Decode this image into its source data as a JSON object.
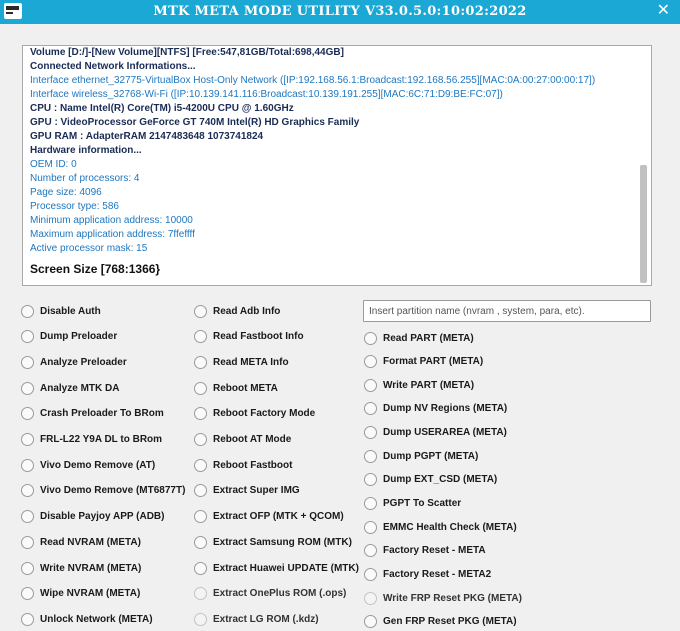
{
  "window": {
    "title": "MTK META MODE UTILITY V33.0.5.0:10:02:2022",
    "close_glyph": "✕",
    "app_icon": "app-logo-icon"
  },
  "log": [
    {
      "text": "Volume [D:/]-[New Volume][NTFS] [Free:547,81GB/Total:698,44GB]",
      "style": "dark"
    },
    {
      "text": "Connected Network Informations...",
      "style": "dark"
    },
    {
      "text": "Interface ethernet_32775-VirtualBox Host-Only Network ([IP:192.168.56.1:Broadcast:192.168.56.255][MAC:0A:00:27:00:00:17])",
      "style": "blue"
    },
    {
      "text": "Interface wireless_32768-Wi-Fi ([IP:10.139.141.116:Broadcast:10.139.191.255][MAC:6C:71:D9:BE:FC:07])",
      "style": "blue"
    },
    {
      "text": "CPU  : Name Intel(R) Core(TM) i5-4200U CPU @ 1.60GHz",
      "style": "dark"
    },
    {
      "text": "GPU  : VideoProcessor GeForce GT 740M Intel(R) HD Graphics Family",
      "style": "dark"
    },
    {
      "text": "GPU RAM  : AdapterRAM 2147483648 1073741824",
      "style": "dark"
    },
    {
      "text": "Hardware information...",
      "style": "dark"
    },
    {
      "text": "OEM ID: 0",
      "style": "blue"
    },
    {
      "text": "Number of processors: 4",
      "style": "blue"
    },
    {
      "text": "Page size: 4096",
      "style": "blue"
    },
    {
      "text": "Processor type: 586",
      "style": "blue"
    },
    {
      "text": "Minimum application address: 10000",
      "style": "blue"
    },
    {
      "text": "Maximum application address: 7ffeffff",
      "style": "blue"
    },
    {
      "text": "Active processor mask: 15",
      "style": "blue"
    },
    {
      "text": "Screen Size [768:1366}",
      "style": "big"
    }
  ],
  "col1": [
    "Disable Auth",
    "Dump Preloader",
    "Analyze Preloader",
    "Analyze MTK DA",
    "Crash Preloader To BRom",
    "FRL-L22 Y9A DL to BRom",
    "Vivo Demo Remove (AT)",
    "Vivo Demo Remove (MT6877T)",
    "Disable Payjoy APP (ADB)",
    "Read NVRAM (META)",
    "Write NVRAM (META)",
    "Wipe NVRAM (META)",
    "Unlock Network (META)"
  ],
  "col2": [
    {
      "label": "Read Adb Info",
      "enabled": true
    },
    {
      "label": "Read Fastboot Info",
      "enabled": true
    },
    {
      "label": "Read META Info",
      "enabled": true
    },
    {
      "label": "Reboot META",
      "enabled": true
    },
    {
      "label": "Reboot Factory Mode",
      "enabled": true
    },
    {
      "label": "Reboot AT Mode",
      "enabled": true
    },
    {
      "label": "Reboot Fastboot",
      "enabled": true
    },
    {
      "label": "Extract Super IMG",
      "enabled": true
    },
    {
      "label": "Extract OFP (MTK + QCOM)",
      "enabled": true
    },
    {
      "label": "Extract Samsung ROM (MTK)",
      "enabled": true
    },
    {
      "label": "Extract Huawei UPDATE (MTK)",
      "enabled": true
    },
    {
      "label": "Extract OnePlus ROM (.ops)",
      "enabled": false
    },
    {
      "label": "Extract LG ROM (.kdz)",
      "enabled": false
    }
  ],
  "partition_input": {
    "placeholder": "Insert partition name (nvram , system, para, etc).",
    "value": ""
  },
  "col3": [
    {
      "label": "Read PART (META)",
      "enabled": true
    },
    {
      "label": "Format PART (META)",
      "enabled": true
    },
    {
      "label": "Write PART (META)",
      "enabled": true
    },
    {
      "label": "Dump NV Regions (META)",
      "enabled": true
    },
    {
      "label": "Dump USERAREA (META)",
      "enabled": true
    },
    {
      "label": "Dump PGPT (META)",
      "enabled": true
    },
    {
      "label": "Dump  EXT_CSD (META)",
      "enabled": true
    },
    {
      "label": "PGPT To Scatter",
      "enabled": true
    },
    {
      "label": "EMMC Health Check (META)",
      "enabled": true
    },
    {
      "label": "Factory Reset - META",
      "enabled": true
    },
    {
      "label": "Factory Reset - META2",
      "enabled": true
    },
    {
      "label": "Write FRP Reset PKG (META)",
      "enabled": false
    },
    {
      "label": "Gen FRP Reset PKG (META)",
      "enabled": true
    }
  ]
}
